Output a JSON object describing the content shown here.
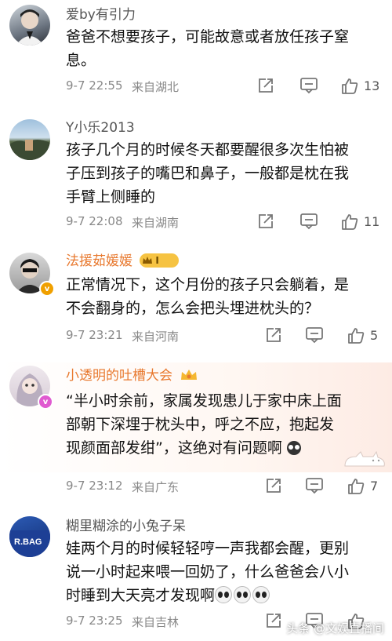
{
  "comments": [
    {
      "username": "爱by有引力",
      "lines": [
        "爸爸不想要孩子，可能故意或者放任孩子窒",
        "息。"
      ],
      "time": "9-7 22:55",
      "location": "来自湖北",
      "likes": "13"
    },
    {
      "username": "Y小乐2013",
      "lines": [
        "孩子几个月的时候冬天都要醒很多次生怕被",
        "子压到孩子的嘴巴和鼻子，一般都是枕在我",
        "手臂上侧睡的"
      ],
      "time": "9-7 22:08",
      "location": "来自湖南",
      "likes": "11"
    },
    {
      "username": "法援茹媛媛",
      "level": "I",
      "lines": [
        "正常情况下，这个月份的孩子只会躺着，是",
        "不会翻身的，怎么会把头埋进枕头的？"
      ],
      "time": "9-7 23:21",
      "location": "来自河南",
      "likes": "5"
    },
    {
      "username": "小透明的吐槽大会",
      "lines": [
        "“半小时余前，家属发现患儿于家中床上面",
        "部朝下深埋于枕头中，呼之不应，抱起发",
        "现颜面部发绀”，这绝对有问题啊"
      ],
      "time": "9-7 23:12",
      "location": "来自广东",
      "likes": "7"
    },
    {
      "username": "糊里糊涂的小兔子呆",
      "lines": [
        "娃两个月的时候轻轻哼一声我都会醒，更别",
        "说一小时起来喂一回奶了，什么爸爸会八小",
        "时睡到大天亮才发现啊"
      ],
      "time": "9-7 23:25",
      "location": "来自吉林",
      "likes": ""
    }
  ],
  "icons": {
    "share": "share-icon",
    "comment": "comment-icon",
    "like": "thumbs-up-icon"
  },
  "colors": {
    "vip_name": "#e8792f",
    "normal_name": "#555555",
    "meta": "#888888"
  },
  "avatar_captions": {
    "c5": "R.BAG"
  },
  "watermark": "头条 @文娱直播间"
}
